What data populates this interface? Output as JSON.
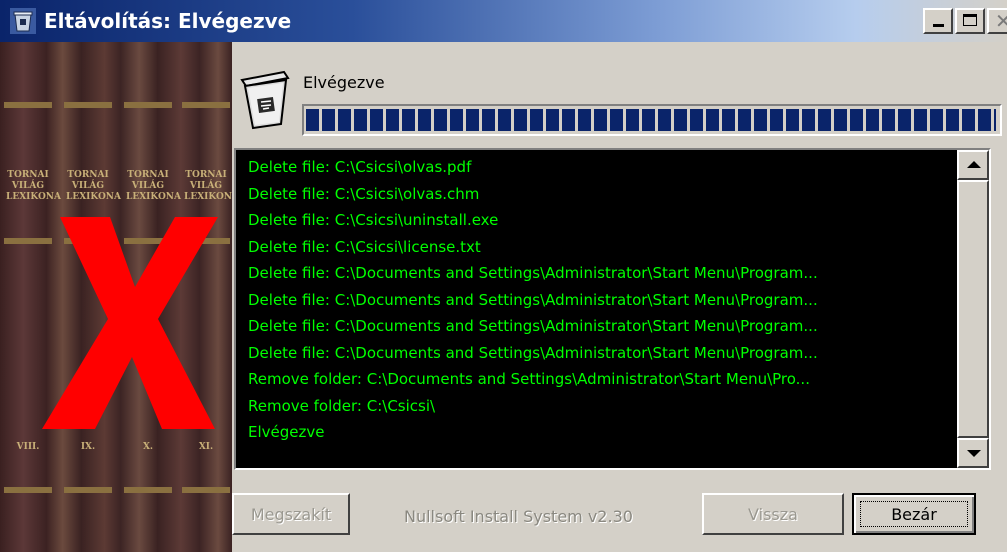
{
  "window": {
    "title": "Eltávolítás: Elvégezve"
  },
  "status": {
    "label": "Elvégezve",
    "progress_percent": 100
  },
  "sidebar": {
    "book_labels": [
      "TORNAI VILÁG LEXIKONA",
      "TORNAI VILÁG LEXIKONA",
      "TORNAI VILÁG LEXIKONA",
      "TORNAI VILÁG LEXIKONA"
    ],
    "volume_labels": [
      "VIII.",
      "IX.",
      "X.",
      "XI."
    ]
  },
  "log": {
    "lines": [
      "Delete file: C:\\Csicsi\\olvas.pdf",
      "Delete file: C:\\Csicsi\\olvas.chm",
      "Delete file: C:\\Csicsi\\uninstall.exe",
      "Delete file: C:\\Csicsi\\license.txt",
      "Delete file: C:\\Documents and Settings\\Administrator\\Start Menu\\Program...",
      "Delete file: C:\\Documents and Settings\\Administrator\\Start Menu\\Program...",
      "Delete file: C:\\Documents and Settings\\Administrator\\Start Menu\\Program...",
      "Delete file: C:\\Documents and Settings\\Administrator\\Start Menu\\Program...",
      "Remove folder: C:\\Documents and Settings\\Administrator\\Start Menu\\Pro...",
      "Remove folder: C:\\Csicsi\\",
      "Elvégezve"
    ],
    "text_color": "#00ff00",
    "background": "#000000"
  },
  "buttons": {
    "cancel": "Megszakít",
    "back": "Vissza",
    "close": "Bezár"
  },
  "branding": "Nullsoft Install System v2.30",
  "colors": {
    "titlebar_start": "#0a246a",
    "progress": "#0a246a",
    "red_x": "#ff0000"
  },
  "icons": {
    "title": "recycle-bin-icon",
    "status": "recycle-bin-icon",
    "minimize": "minimize-icon",
    "maximize": "maximize-icon",
    "close": "close-icon"
  }
}
